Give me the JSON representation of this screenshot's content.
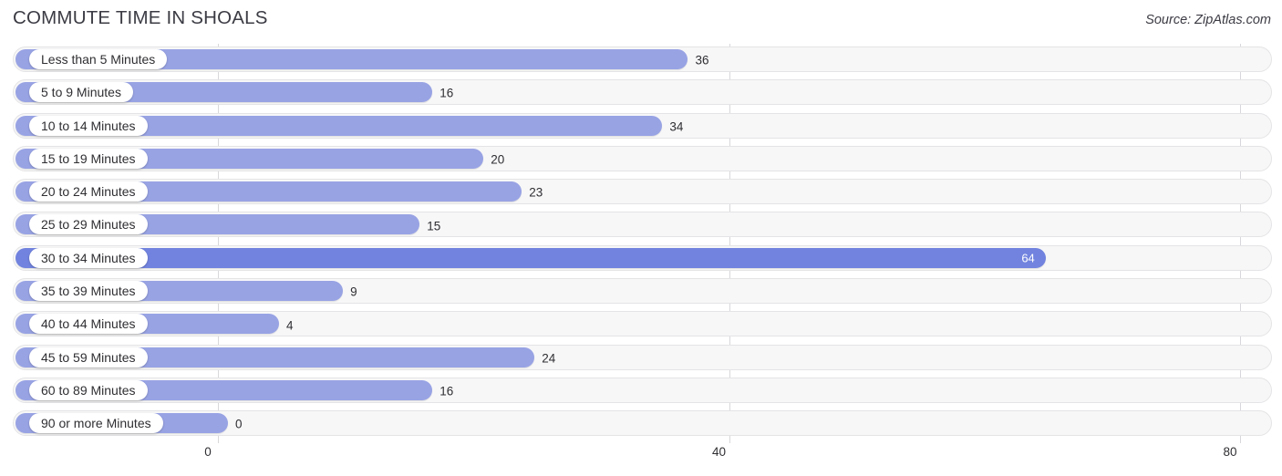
{
  "header": {
    "title": "COMMUTE TIME IN SHOALS",
    "source": "Source: ZipAtlas.com"
  },
  "colors": {
    "bar": "#98a3e4",
    "bar_highlight": "#7183de",
    "track": "#f7f7f8",
    "track_border": "#e4e4e6",
    "gridline": "#d8d8dc",
    "text": "#2f2f33",
    "title": "#3b3b44"
  },
  "axis": {
    "ticks": [
      {
        "label": "0",
        "value": 0
      },
      {
        "label": "40",
        "value": 40
      },
      {
        "label": "80",
        "value": 80
      }
    ]
  },
  "chart_data": {
    "type": "bar",
    "orientation": "horizontal",
    "title": "COMMUTE TIME IN SHOALS",
    "subtitle": "Source: ZipAtlas.com",
    "xlabel": "",
    "ylabel": "",
    "xlim": [
      0,
      80
    ],
    "grid": true,
    "legend": false,
    "categories": [
      "Less than 5 Minutes",
      "5 to 9 Minutes",
      "10 to 14 Minutes",
      "15 to 19 Minutes",
      "20 to 24 Minutes",
      "25 to 29 Minutes",
      "30 to 34 Minutes",
      "35 to 39 Minutes",
      "40 to 44 Minutes",
      "45 to 59 Minutes",
      "60 to 89 Minutes",
      "90 or more Minutes"
    ],
    "values": [
      36,
      16,
      34,
      20,
      23,
      15,
      64,
      9,
      4,
      24,
      16,
      0
    ],
    "highlight_index": 6,
    "rows": [
      {
        "label": "Less than 5 Minutes",
        "value": 36,
        "value_label": "36",
        "highlight": false
      },
      {
        "label": "5 to 9 Minutes",
        "value": 16,
        "value_label": "16",
        "highlight": false
      },
      {
        "label": "10 to 14 Minutes",
        "value": 34,
        "value_label": "34",
        "highlight": false
      },
      {
        "label": "15 to 19 Minutes",
        "value": 20,
        "value_label": "20",
        "highlight": false
      },
      {
        "label": "20 to 24 Minutes",
        "value": 23,
        "value_label": "23",
        "highlight": false
      },
      {
        "label": "25 to 29 Minutes",
        "value": 15,
        "value_label": "15",
        "highlight": false
      },
      {
        "label": "30 to 34 Minutes",
        "value": 64,
        "value_label": "64",
        "highlight": true
      },
      {
        "label": "35 to 39 Minutes",
        "value": 9,
        "value_label": "9",
        "highlight": false
      },
      {
        "label": "40 to 44 Minutes",
        "value": 4,
        "value_label": "4",
        "highlight": false
      },
      {
        "label": "45 to 59 Minutes",
        "value": 24,
        "value_label": "24",
        "highlight": false
      },
      {
        "label": "60 to 89 Minutes",
        "value": 16,
        "value_label": "16",
        "highlight": false
      },
      {
        "label": "90 or more Minutes",
        "value": 0,
        "value_label": "0",
        "highlight": false
      }
    ]
  }
}
